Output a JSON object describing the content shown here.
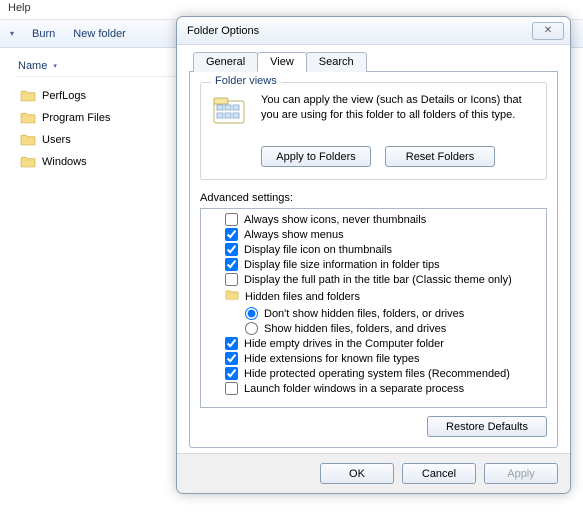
{
  "explorer": {
    "menu": {
      "help": "Help"
    },
    "toolbar": {
      "burn": "Burn",
      "new_folder": "New folder"
    },
    "columns": {
      "name": "Name"
    },
    "items": [
      {
        "label": "PerfLogs"
      },
      {
        "label": "Program Files"
      },
      {
        "label": "Users"
      },
      {
        "label": "Windows"
      }
    ]
  },
  "dialog": {
    "title": "Folder Options",
    "tabs": {
      "general": "General",
      "view": "View",
      "search": "Search"
    },
    "folder_views": {
      "legend": "Folder views",
      "text": "You can apply the view (such as Details or Icons) that you are using for this folder to all folders of this type.",
      "apply_btn": "Apply to Folders",
      "reset_btn": "Reset Folders"
    },
    "advanced": {
      "label": "Advanced settings:",
      "items": [
        {
          "kind": "check",
          "checked": false,
          "label": "Always show icons, never thumbnails"
        },
        {
          "kind": "check",
          "checked": true,
          "label": "Always show menus"
        },
        {
          "kind": "check",
          "checked": true,
          "label": "Display file icon on thumbnails"
        },
        {
          "kind": "check",
          "checked": true,
          "label": "Display file size information in folder tips"
        },
        {
          "kind": "check",
          "checked": false,
          "label": "Display the full path in the title bar (Classic theme only)"
        },
        {
          "kind": "group",
          "label": "Hidden files and folders"
        },
        {
          "kind": "radio",
          "checked": true,
          "label": "Don't show hidden files, folders, or drives"
        },
        {
          "kind": "radio",
          "checked": false,
          "label": "Show hidden files, folders, and drives"
        },
        {
          "kind": "check",
          "checked": true,
          "label": "Hide empty drives in the Computer folder"
        },
        {
          "kind": "check",
          "checked": true,
          "label": "Hide extensions for known file types"
        },
        {
          "kind": "check",
          "checked": true,
          "label": "Hide protected operating system files (Recommended)"
        },
        {
          "kind": "check",
          "checked": false,
          "label": "Launch folder windows in a separate process"
        }
      ],
      "restore_btn": "Restore Defaults"
    },
    "footer": {
      "ok": "OK",
      "cancel": "Cancel",
      "apply": "Apply"
    }
  }
}
